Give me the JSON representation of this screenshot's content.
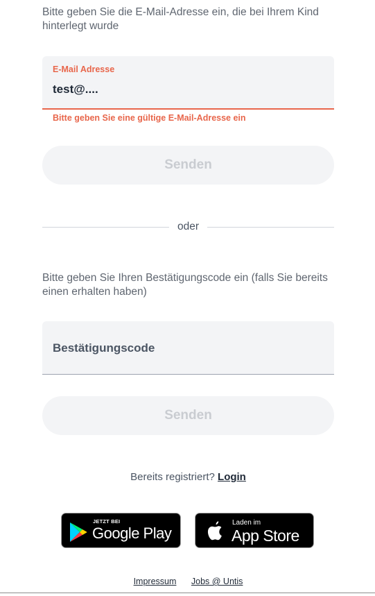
{
  "email_section": {
    "intro": "Bitte geben Sie die E-Mail-Adresse ein, die bei Ihrem Kind hinterlegt wurde",
    "field_label": "E-Mail Adresse",
    "field_value": "test@....",
    "error": "Bitte geben Sie eine gültige E-Mail-Adresse ein",
    "submit_label": "Senden"
  },
  "divider": {
    "label": "oder"
  },
  "code_section": {
    "intro": "Bitte geben Sie Ihren Bestätigungscode ein (falls Sie bereits einen erhalten haben)",
    "placeholder": "Bestätigungscode",
    "submit_label": "Senden"
  },
  "login": {
    "prompt": "Bereits registriert?",
    "link": "Login"
  },
  "badges": {
    "google": {
      "small": "JETZT BEI",
      "big": "Google Play",
      "icon": "google-play-logo"
    },
    "apple": {
      "small": "Laden im",
      "big": "App Store",
      "icon": "apple-logo"
    }
  },
  "footer": {
    "links": [
      "Impressum",
      "Jobs @ Untis"
    ]
  },
  "colors": {
    "error": "#e8664b",
    "field_bg": "#f3f4f6",
    "button_text_disabled": "#c9ccd1"
  }
}
